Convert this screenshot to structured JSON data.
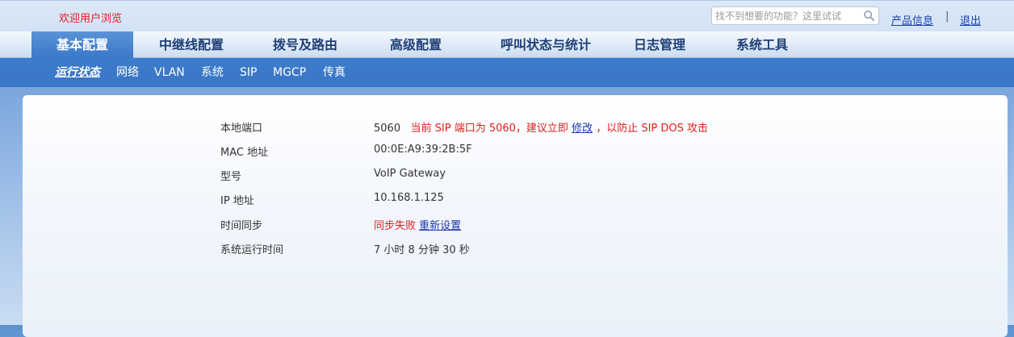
{
  "header": {
    "welcome": "欢迎用户浏览",
    "search": {
      "placeholder": "找不到想要的功能？这里试试"
    },
    "product_info": "产品信息",
    "separator": "|",
    "logout": "退出"
  },
  "main_nav": {
    "items": [
      {
        "label": "基本配置",
        "active": true
      },
      {
        "label": "中继线配置"
      },
      {
        "label": "拨号及路由"
      },
      {
        "label": "高级配置"
      },
      {
        "label": "呼叫状态与统计"
      },
      {
        "label": "日志管理"
      },
      {
        "label": "系统工具"
      }
    ]
  },
  "sub_nav": {
    "items": [
      {
        "label": "运行状态",
        "active": true
      },
      {
        "label": "网络"
      },
      {
        "label": "VLAN"
      },
      {
        "label": "系统"
      },
      {
        "label": "SIP"
      },
      {
        "label": "MGCP"
      },
      {
        "label": "传真"
      }
    ]
  },
  "status": {
    "local_port": {
      "label": "本地端口",
      "value": "5060",
      "warning_prefix": "当前 SIP 端口为 5060，建议立即",
      "warning_link": "修改",
      "warning_suffix": "，以防止 SIP DOS 攻击"
    },
    "mac": {
      "label": "MAC 地址",
      "value": "00:0E:A9:39:2B:5F"
    },
    "model": {
      "label": "型号",
      "value": "VoIP Gateway"
    },
    "ip": {
      "label": "IP 地址",
      "value": "10.168.1.125"
    },
    "time_sync": {
      "label": "时间同步",
      "value": "同步失败",
      "link": "重新设置"
    },
    "uptime": {
      "label": "系统运行时间",
      "value": "7 小时 8 分钟 30 秒"
    }
  },
  "colors": {
    "accent": "#3a76c6",
    "warning": "#e01e1e",
    "link": "#1a35a8"
  }
}
